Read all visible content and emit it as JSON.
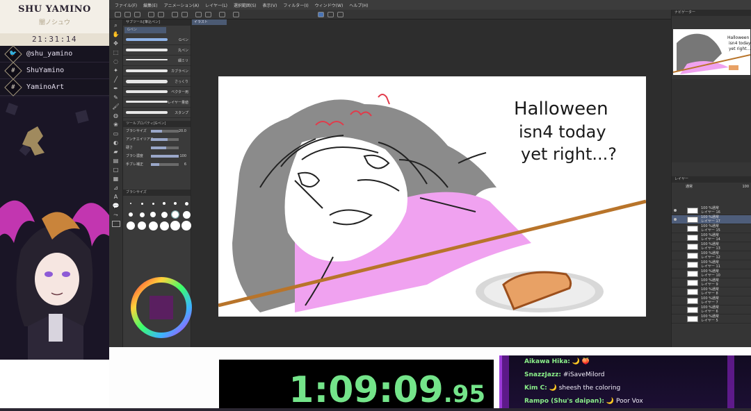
{
  "overlay": {
    "brand_name": "SHU YAMINO",
    "brand_kana": "闇ノシュウ",
    "clock": "21:31:14",
    "socials": [
      {
        "icon": "twitter-icon",
        "glyph": "🐦",
        "label": "@shu_yamino"
      },
      {
        "icon": "hashtag-icon",
        "glyph": "#",
        "label": "ShuYamino"
      },
      {
        "icon": "hashtag-icon",
        "glyph": "#",
        "label": "YaminoArt"
      }
    ]
  },
  "app": {
    "menu": [
      "ファイル(F)",
      "編集(E)",
      "アニメーション(A)",
      "レイヤー(L)",
      "選択範囲(S)",
      "表示(V)",
      "フィルター(I)",
      "ウィンドウ(W)",
      "ヘルプ(H)"
    ],
    "subtool_title": "サブツール[筆込ペン]",
    "subtool_tab": "Gペン",
    "brushes": [
      "Gペン",
      "丸ペン",
      "細ミリ",
      "カブラペン",
      "さっくり",
      "ベクター用",
      "レイヤー量値",
      "スタンプ"
    ],
    "props_title": "ツールプロパティ[Gペン]",
    "props": [
      {
        "label": "ブラシサイズ",
        "value": "20.0",
        "fill": 0.4
      },
      {
        "label": "アンチエイリアス",
        "value": "",
        "fill": 0.6
      },
      {
        "label": "硬さ",
        "value": "",
        "fill": 0.55
      },
      {
        "label": "ブラシ濃度",
        "value": "100",
        "fill": 1.0
      },
      {
        "label": "手ブレ補正",
        "value": "6",
        "fill": 0.3
      }
    ],
    "brush_size_title": "ブラシサイズ",
    "canvas_tab": "イラスト",
    "drawing_text": [
      "Halloween",
      "isn4 today",
      "yet right...?"
    ],
    "navigator_title": "ナビゲーター",
    "layer_title": "レイヤー",
    "blend_mode": "通常",
    "opacity": "100",
    "layers": [
      {
        "opacity": "100 %通常",
        "name": "レイヤー 16",
        "selected": false
      },
      {
        "opacity": "100 %通常",
        "name": "レイヤー 17",
        "selected": true
      },
      {
        "opacity": "100 %通常",
        "name": "レイヤー 15",
        "selected": false
      },
      {
        "opacity": "100 %通常",
        "name": "レイヤー 14",
        "selected": false
      },
      {
        "opacity": "100 %通常",
        "name": "レイヤー 13",
        "selected": false
      },
      {
        "opacity": "100 %通常",
        "name": "レイヤー 12",
        "selected": false
      },
      {
        "opacity": "100 %通常",
        "name": "レイヤー 11",
        "selected": false
      },
      {
        "opacity": "100 %通常",
        "name": "レイヤー 10",
        "selected": false
      },
      {
        "opacity": "100 %通常",
        "name": "レイヤー 9",
        "selected": false
      },
      {
        "opacity": "100 %通常",
        "name": "レイヤー 8",
        "selected": false
      },
      {
        "opacity": "100 %通常",
        "name": "レイヤー 7",
        "selected": false
      },
      {
        "opacity": "100 %通常",
        "name": "レイヤー 6",
        "selected": false
      },
      {
        "opacity": "100 %通常",
        "name": "レイヤー 5",
        "selected": false
      }
    ]
  },
  "timer": {
    "main": "1:09:09",
    "fraction": ".95",
    "color": "#74e48a"
  },
  "chat": [
    {
      "user": "Aikawa Hika:",
      "message": "🌙 🍑"
    },
    {
      "user": "SnazzJazz:",
      "message": "#iSaveMilord"
    },
    {
      "user": "Kim C:",
      "message": "🌙 sheesh the coloring"
    },
    {
      "user": "Rampo (Shu's daipan):",
      "message": "🌙 Poor Vox"
    }
  ]
}
